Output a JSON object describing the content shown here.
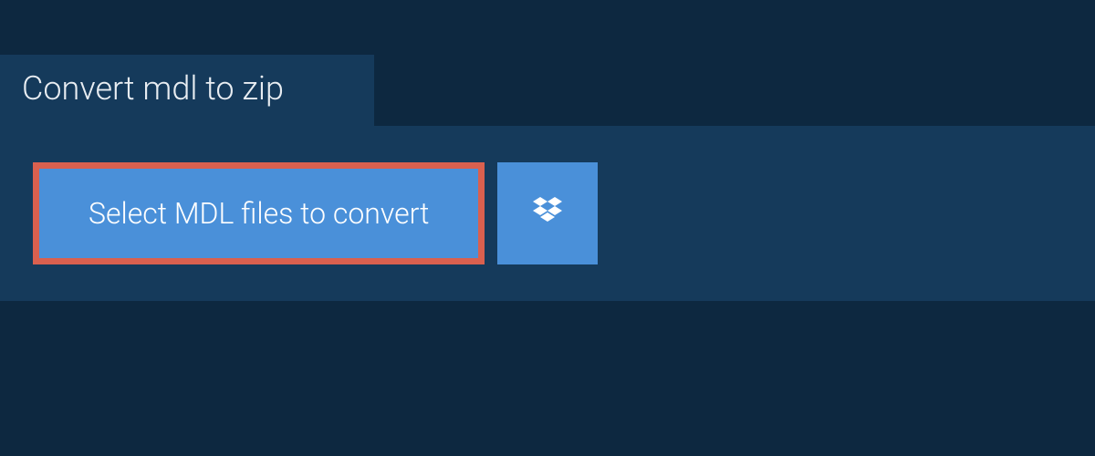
{
  "tab": {
    "label": "Convert mdl to zip"
  },
  "actions": {
    "select_label": "Select MDL files to convert"
  },
  "colors": {
    "background": "#0d2840",
    "panel": "#153a5b",
    "button": "#4a90d9",
    "highlight_border": "#d9604f"
  }
}
